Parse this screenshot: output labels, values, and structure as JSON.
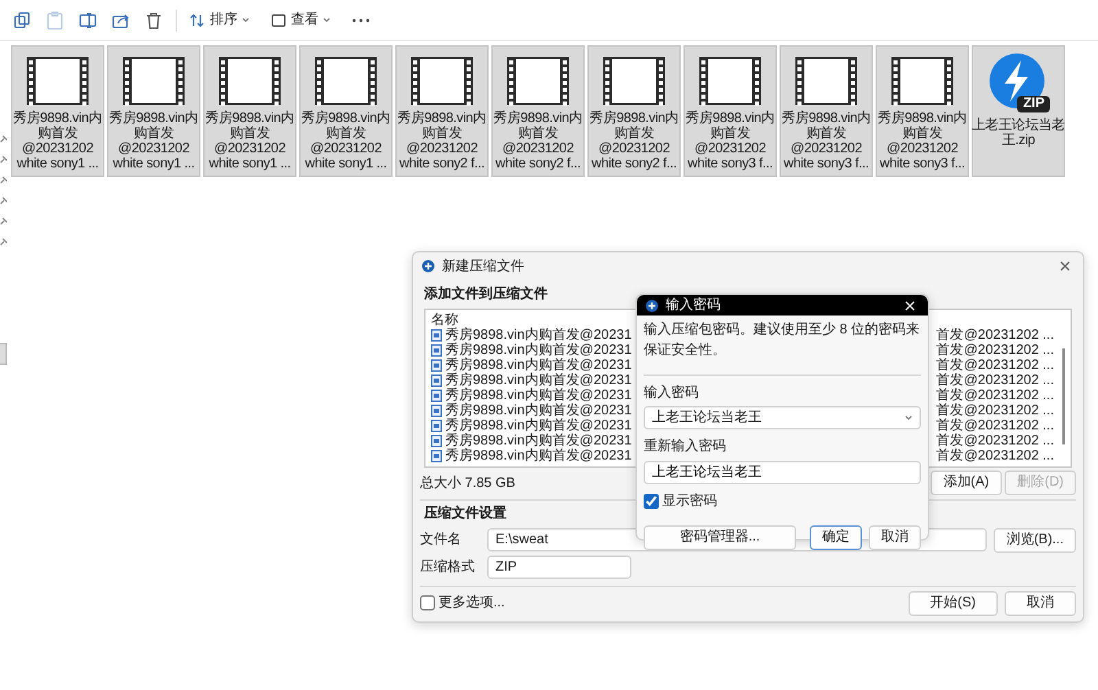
{
  "toolbar": {
    "icon_buttons": [
      {
        "kind": "copy",
        "disabled": false
      },
      {
        "kind": "paste",
        "disabled": true
      },
      {
        "kind": "rename",
        "disabled": false
      },
      {
        "kind": "share",
        "disabled": false
      },
      {
        "kind": "delete",
        "disabled": false
      }
    ],
    "sort": {
      "label": "排序"
    },
    "view": {
      "label": "查看"
    }
  },
  "files": [
    {
      "kind": "video",
      "selected": true,
      "lines": [
        "秀房9898.vin内",
        "购首发",
        "@20231202",
        "white sony1 ..."
      ]
    },
    {
      "kind": "video",
      "selected": true,
      "lines": [
        "秀房9898.vin内",
        "购首发",
        "@20231202",
        "white sony1 ..."
      ]
    },
    {
      "kind": "video",
      "selected": true,
      "lines": [
        "秀房9898.vin内",
        "购首发",
        "@20231202",
        "white sony1 ..."
      ]
    },
    {
      "kind": "video",
      "selected": true,
      "lines": [
        "秀房9898.vin内",
        "购首发",
        "@20231202",
        "white sony1 ..."
      ]
    },
    {
      "kind": "video",
      "selected": true,
      "lines": [
        "秀房9898.vin内",
        "购首发",
        "@20231202",
        "white sony2 f..."
      ]
    },
    {
      "kind": "video",
      "selected": true,
      "lines": [
        "秀房9898.vin内",
        "购首发",
        "@20231202",
        "white sony2 f..."
      ]
    },
    {
      "kind": "video",
      "selected": true,
      "lines": [
        "秀房9898.vin内",
        "购首发",
        "@20231202",
        "white sony2 f..."
      ]
    },
    {
      "kind": "video",
      "selected": true,
      "lines": [
        "秀房9898.vin内",
        "购首发",
        "@20231202",
        "white sony3 f..."
      ]
    },
    {
      "kind": "video",
      "selected": true,
      "lines": [
        "秀房9898.vin内",
        "购首发",
        "@20231202",
        "white sony3 f..."
      ]
    },
    {
      "kind": "video",
      "selected": true,
      "lines": [
        "秀房9898.vin内",
        "购首发",
        "@20231202",
        "white sony3 f..."
      ]
    },
    {
      "kind": "zip",
      "selected": true,
      "badge": "ZIP",
      "lines": [
        "上老王论坛当老",
        "王.zip"
      ]
    }
  ],
  "archive_dialog": {
    "title": "新建压缩文件",
    "section_add": "添加文件到压缩文件",
    "list_header": "名称",
    "rows": [
      {
        "left": "秀房9898.vin内购首发@20231",
        "right": "首发@20231202 ..."
      },
      {
        "left": "秀房9898.vin内购首发@20231",
        "right": "首发@20231202 ..."
      },
      {
        "left": "秀房9898.vin内购首发@20231",
        "right": "首发@20231202 ..."
      },
      {
        "left": "秀房9898.vin内购首发@20231",
        "right": "首发@20231202 ..."
      },
      {
        "left": "秀房9898.vin内购首发@20231",
        "right": "首发@20231202 ..."
      },
      {
        "left": "秀房9898.vin内购首发@20231",
        "right": "首发@20231202 ..."
      },
      {
        "left": "秀房9898.vin内购首发@20231",
        "right": "首发@20231202 ..."
      },
      {
        "left": "秀房9898.vin内购首发@20231",
        "right": "首发@20231202 ..."
      },
      {
        "left": "秀房9898.vin内购首发@20231",
        "right": "首发@20231202 ..."
      }
    ],
    "total_size": "总大小 7.85 GB",
    "add_button": {
      "label": "添加(A)",
      "disabled": false
    },
    "remove_button": {
      "label": "删除(D)",
      "disabled": true
    },
    "section_settings": "压缩文件设置",
    "filename_label": "文件名",
    "filename_value": "E:\\sweat",
    "browse_button": "浏览(B)...",
    "format_label": "压缩格式",
    "format_value": "ZIP",
    "more_options": {
      "label": "更多选项...",
      "checked": false
    },
    "start_button": "开始(S)",
    "cancel_button": "取消"
  },
  "password_dialog": {
    "title": "输入密码",
    "hint": "输入压缩包密码。建议使用至少 8 位的密码来保证安全性。",
    "password_label": "输入密码",
    "password_value": "上老王论坛当老王",
    "confirm_label": "重新输入密码",
    "confirm_value": "上老王论坛当老王",
    "show_password": {
      "label": "显示密码",
      "checked": true
    },
    "manager_button": "密码管理器...",
    "ok_button": "确定",
    "cancel_button": "取消"
  }
}
